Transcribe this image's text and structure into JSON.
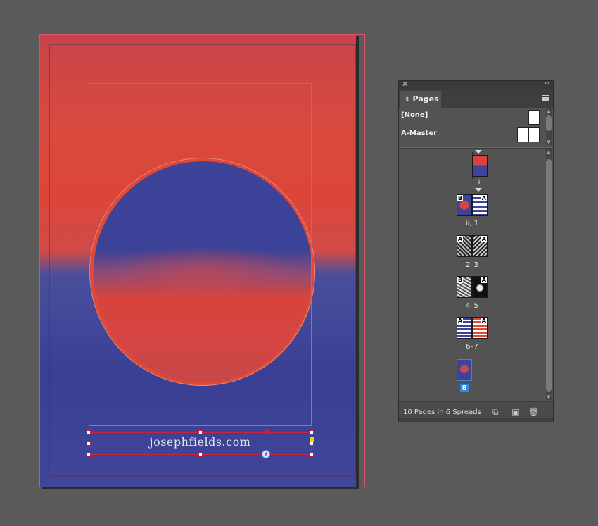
{
  "document": {
    "url_text": "josephfields.com"
  },
  "pages_panel": {
    "tab_label": "Pages",
    "masters": [
      {
        "label": "[None]"
      },
      {
        "label": "A-Master"
      }
    ],
    "spreads": [
      {
        "label": "i"
      },
      {
        "label": "ii, 1"
      },
      {
        "label": "2–3"
      },
      {
        "label": "4–5"
      },
      {
        "label": "6–7"
      },
      {
        "label": "8"
      }
    ],
    "status": "10 Pages in 6 Spreads",
    "page_master_letters": [
      "B",
      "A",
      "A",
      "A",
      "B",
      "A",
      "A",
      "A"
    ]
  },
  "colors": {
    "pasteboard": "#5a5a5a",
    "panel_bg": "#535353",
    "selection": "#c8233a",
    "margin_guide": "#c84fc8",
    "art_red": "#dc4638",
    "art_blue": "#3a3f94",
    "current_page_highlight": "#2d8ae0"
  },
  "icons": [
    "close-icon",
    "collapse-icon",
    "panel-menu-icon",
    "edit-page-size-icon",
    "new-page-icon",
    "delete-page-icon"
  ]
}
